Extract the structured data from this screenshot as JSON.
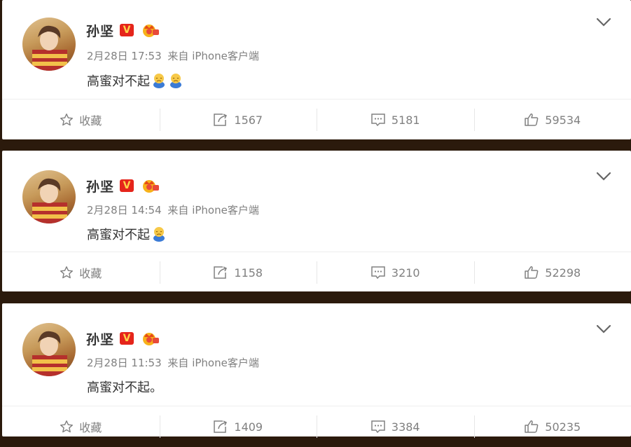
{
  "posts": [
    {
      "user": "孙坚",
      "time": "2月28日 17:53",
      "source": "来自 iPhone客户端",
      "text": "高蜜对不起",
      "emoji_count": 2,
      "actions": {
        "favorite": "收藏",
        "repost": "1567",
        "comment": "5181",
        "like": "59534"
      }
    },
    {
      "user": "孙坚",
      "time": "2月28日 14:54",
      "source": "来自 iPhone客户端",
      "text": "高蜜对不起",
      "emoji_count": 1,
      "actions": {
        "favorite": "收藏",
        "repost": "1158",
        "comment": "3210",
        "like": "52298"
      }
    },
    {
      "user": "孙坚",
      "time": "2月28日 11:53",
      "source": "来自 iPhone客户端",
      "text": "高蜜对不起。",
      "emoji_count": 0,
      "actions": {
        "favorite": "收藏",
        "repost": "1409",
        "comment": "3384",
        "like": "50235"
      }
    }
  ],
  "badges": {
    "verified_letter": "V"
  },
  "icons": {
    "favorite": "star-icon",
    "repost": "repost-icon",
    "comment": "comment-icon",
    "like": "thumbs-up-icon",
    "menu": "chevron-down-icon",
    "emoji": "sad-face-emoji"
  },
  "colors": {
    "background": "#2b1a0c",
    "verified": "#e5251b",
    "text_muted": "#808080"
  }
}
